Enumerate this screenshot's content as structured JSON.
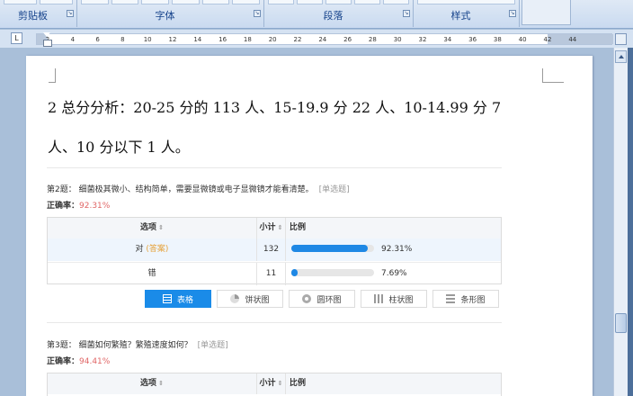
{
  "ribbon": {
    "groups": [
      {
        "label": "剪贴板"
      },
      {
        "label": "字体"
      },
      {
        "label": "段落"
      },
      {
        "label": "样式"
      }
    ],
    "launcher_glyph": "↘"
  },
  "ruler": {
    "tab_glyph": "L",
    "ticks": [
      "2",
      "4",
      "6",
      "8",
      "10",
      "12",
      "14",
      "16",
      "18",
      "20",
      "22",
      "24",
      "26",
      "28",
      "30",
      "32",
      "34",
      "36",
      "38",
      "40",
      "42",
      "44"
    ]
  },
  "document": {
    "line1": "2 总分分析：20-25 分的 113 人、15-19.9 分 22 人、10-14.99 分 7",
    "line2": "人、10 分以下 1 人。"
  },
  "survey": {
    "q2": {
      "title": "第2题：  细菌极其微小、结构简单，需要显微镜或电子显微镜才能看清楚。",
      "type": "[单选题]",
      "accuracy_label": "正确率：",
      "accuracy_value": "92.31%",
      "headers": {
        "option": "选项",
        "count": "小计",
        "ratio": "比例",
        "sort": "⇕"
      },
      "rows": [
        {
          "option": "对",
          "tag": "(答案)",
          "count": "132",
          "fraction": 0.9231,
          "percent": "92.31%"
        },
        {
          "option": "错",
          "tag": "",
          "count": "11",
          "fraction": 0.0769,
          "percent": "7.69%"
        }
      ],
      "views": [
        {
          "label": "表格",
          "icon": "table-icon",
          "active": true
        },
        {
          "label": "饼状图",
          "icon": "pie-chart-icon",
          "active": false
        },
        {
          "label": "圆环图",
          "icon": "ring-chart-icon",
          "active": false
        },
        {
          "label": "柱状图",
          "icon": "column-chart-icon",
          "active": false
        },
        {
          "label": "条形图",
          "icon": "bar-chart-icon",
          "active": false
        }
      ]
    },
    "q3": {
      "title": "第3题：  细菌如何繁殖？繁殖速度如何？",
      "type": "[单选题]",
      "accuracy_label": "正确率：",
      "accuracy_value": "94.41%",
      "headers": {
        "option": "选项",
        "count": "小计",
        "ratio": "比例",
        "sort": "⇕"
      }
    }
  }
}
